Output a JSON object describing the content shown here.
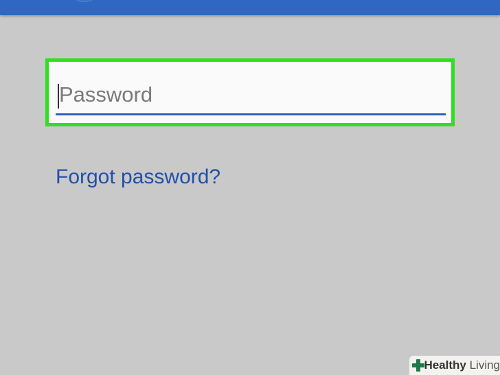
{
  "colors": {
    "top_bar": "#2f67c3",
    "background": "#c9c9c9",
    "highlight_border": "#2de024",
    "field_underline": "#2c60c4",
    "link": "#2150a9",
    "watermark_logo": "#1f7a4a"
  },
  "password": {
    "placeholder": "Password",
    "value": ""
  },
  "links": {
    "forgot_password": "Forgot password?"
  },
  "watermark": {
    "icon": "plus-cross-icon",
    "brand_bold": "Healthy",
    "brand_light": " Living"
  }
}
